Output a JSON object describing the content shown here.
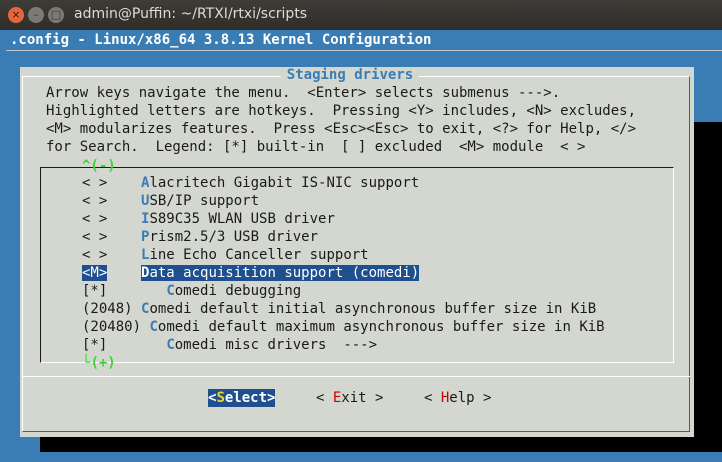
{
  "window": {
    "title": "admin@Puffin: ~/RTXI/rtxi/scripts",
    "buttons": {
      "close": "×",
      "minimize": "–",
      "maximize": "□"
    }
  },
  "terminal": {
    "config_title": ".config - Linux/x86_64 3.8.13 Kernel Configuration"
  },
  "dialog": {
    "title": "Staging drivers",
    "help_lines": [
      "Arrow keys navigate the menu.  <Enter> selects submenus --->.",
      "Highlighted letters are hotkeys.  Pressing <Y> includes, <N> excludes,",
      "<M> modularizes features.  Press <Esc><Esc> to exit, <?> for Help, </>",
      "for Search.  Legend: [*] built-in  [ ] excluded  <M> module  < >"
    ],
    "scroll_up": "^(-)",
    "scroll_down": "(+)",
    "items": [
      {
        "state": "< >",
        "indent": "    ",
        "hotkey": "A",
        "rest": "lacritech Gigabit IS-NIC support"
      },
      {
        "state": "< >",
        "indent": "    ",
        "hotkey": "U",
        "rest": "SB/IP support"
      },
      {
        "state": "< >",
        "indent": "    ",
        "hotkey": "I",
        "rest": "S89C35 WLAN USB driver"
      },
      {
        "state": "< >",
        "indent": "    ",
        "hotkey": "P",
        "rest": "rism2.5/3 USB driver"
      },
      {
        "state": "< >",
        "indent": "    ",
        "hotkey": "L",
        "rest": "ine Echo Canceller support"
      },
      {
        "state": "<M>",
        "indent": "    ",
        "hotkey": "D",
        "rest": "ata acquisition support (comedi)",
        "selected": true
      },
      {
        "state": "[*]",
        "indent": "       ",
        "hotkey": "C",
        "rest": "omedi debugging"
      },
      {
        "state": "(2048)",
        "indent": " ",
        "hotkey": "C",
        "rest": "omedi default initial asynchronous buffer size in KiB"
      },
      {
        "state": "(20480)",
        "indent": " ",
        "hotkey": "C",
        "rest": "omedi default maximum asynchronous buffer size in KiB"
      },
      {
        "state": "[*]",
        "indent": "       ",
        "hotkey": "C",
        "rest": "omedi misc drivers  --->"
      }
    ],
    "buttons": [
      {
        "pre": "<",
        "hot": "S",
        "post": "elect>",
        "selected": true
      },
      {
        "pre": "< ",
        "hot": "E",
        "post": "xit >",
        "selected": false
      },
      {
        "pre": "< ",
        "hot": "H",
        "post": "elp >",
        "selected": false
      }
    ]
  }
}
